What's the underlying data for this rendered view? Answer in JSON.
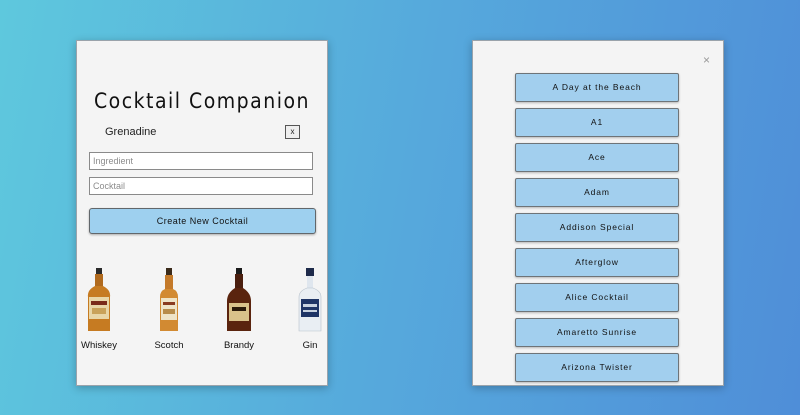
{
  "app": {
    "title": "Cocktail Companion",
    "selected_ingredients": [
      "Grenadine"
    ],
    "remove_label": "x",
    "ingredient_placeholder": "Ingredient",
    "cocktail_placeholder": "Cocktail",
    "create_button_label": "Create New Cocktail",
    "spirits": [
      {
        "label": "Whiskey",
        "icon": "whiskey-bottle-icon"
      },
      {
        "label": "Scotch",
        "icon": "scotch-bottle-icon"
      },
      {
        "label": "Brandy",
        "icon": "brandy-bottle-icon"
      },
      {
        "label": "Gin",
        "icon": "gin-bottle-icon"
      }
    ]
  },
  "cocktail_panel": {
    "close_label": "×",
    "cocktails": [
      "A Day at the Beach",
      "A1",
      "Ace",
      "Adam",
      "Addison Special",
      "Afterglow",
      "Alice Cocktail",
      "Amaretto Sunrise",
      "Arizona Twister"
    ]
  },
  "colors": {
    "button": "#a2cfee",
    "panel": "#f4f4f4"
  }
}
